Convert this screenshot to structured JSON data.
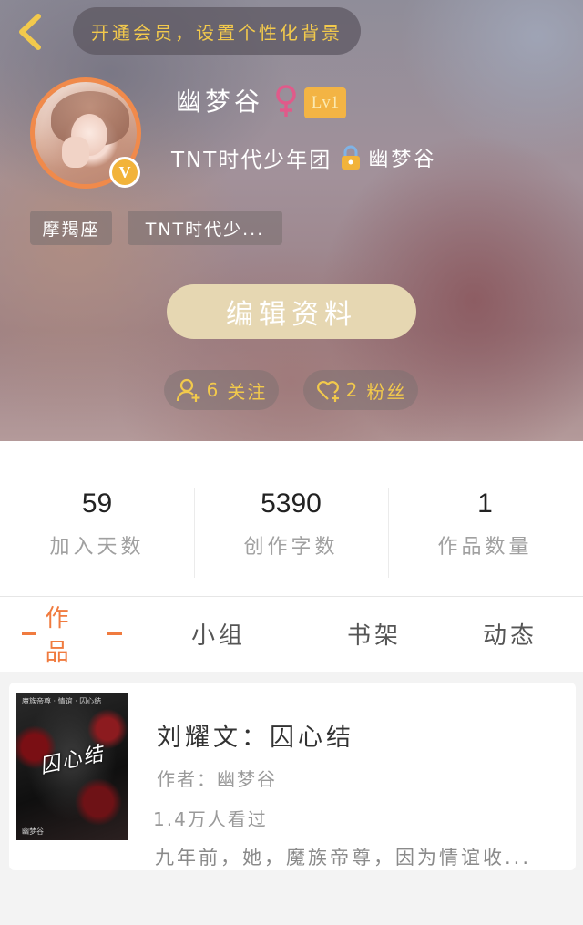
{
  "header": {
    "vip_banner": "开通会员，设置个性化背景",
    "username": "幽梦谷",
    "level": "Lv1",
    "verified_badge": "V",
    "group_name": "TNT时代少年团",
    "group_owner": "幽梦谷",
    "tags": [
      "摩羯座",
      "TNT时代少..."
    ],
    "edit_button": "编辑资料",
    "follow_count": "6",
    "follow_label": "关注",
    "fans_count": "2",
    "fans_label": "粉丝",
    "icons": {
      "back": "back-arrow-icon",
      "gender": "female-gender-icon",
      "lock": "lock-icon",
      "follow": "person-add-icon",
      "fans": "heart-add-icon"
    }
  },
  "stats": [
    {
      "value": "59",
      "label": "加入天数"
    },
    {
      "value": "5390",
      "label": "创作字数"
    },
    {
      "value": "1",
      "label": "作品数量"
    }
  ],
  "tabs": [
    {
      "label": "作品",
      "active": true
    },
    {
      "label": "小组",
      "active": false
    },
    {
      "label": "书架",
      "active": false
    },
    {
      "label": "动态",
      "active": false
    }
  ],
  "works": [
    {
      "title": "刘耀文：囚心结",
      "author": "作者：幽梦谷",
      "views": "1.4万人看过",
      "description": "九年前，她，魔族帝尊，因为情谊收...",
      "cover": {
        "title": "囚心结",
        "top_text": "魔族帝尊 · 情谊 · 囚心结",
        "bottom_text": "幽梦谷"
      }
    }
  ],
  "colors": {
    "accent": "#f07b3f",
    "gold": "#f2c94c",
    "level_badge": "#f3b444",
    "edit_button": "#e6d7b2",
    "gender": "#e05a8a"
  }
}
